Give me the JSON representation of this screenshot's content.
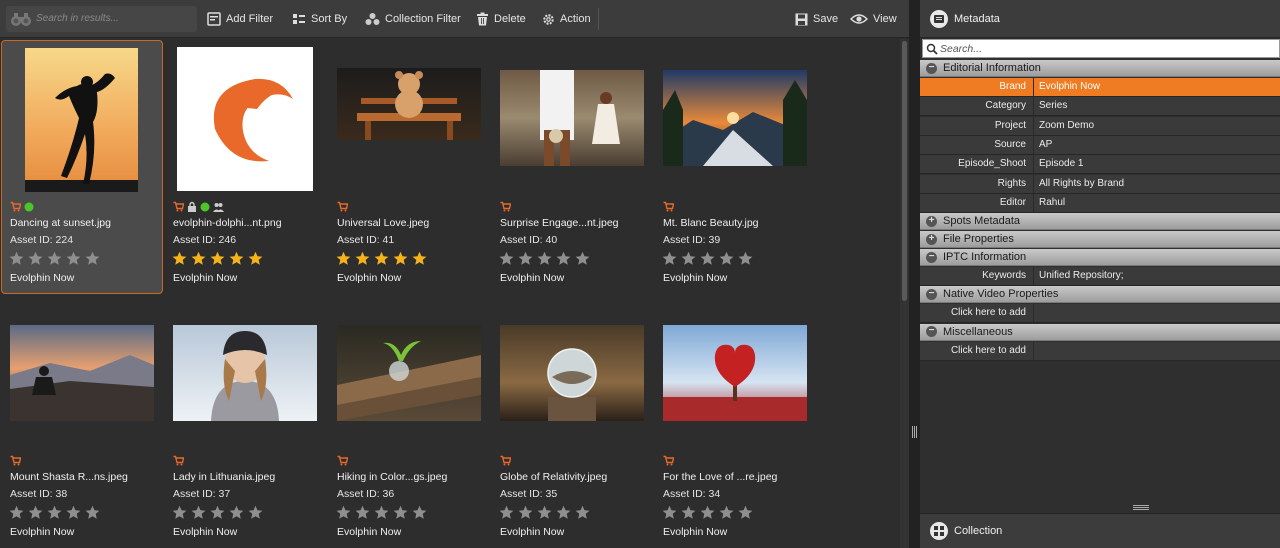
{
  "toolbar": {
    "search_placeholder": "Search in results...",
    "add_filter": "Add Filter",
    "sort_by": "Sort By",
    "collection_filter": "Collection Filter",
    "delete": "Delete",
    "action": "Action",
    "save": "Save",
    "view": "View"
  },
  "assets": [
    {
      "name": "Dancing at sunset.jpg",
      "id": "Asset ID: 224",
      "brand": "Evolphin Now",
      "rating": 0,
      "icons": [
        "cart-icon",
        "green-status-icon"
      ],
      "selected": true
    },
    {
      "name": "evolphin-dolphi...nt.png",
      "id": "Asset ID: 246",
      "brand": "Evolphin Now",
      "rating": 5,
      "icons": [
        "cart-icon",
        "lock-icon",
        "green-status-icon",
        "users-icon"
      ]
    },
    {
      "name": "Universal Love.jpeg",
      "id": "Asset ID: 41",
      "brand": "Evolphin Now",
      "rating": 5,
      "icons": [
        "cart-icon"
      ]
    },
    {
      "name": "Surprise Engage...nt.jpeg",
      "id": "Asset ID: 40",
      "brand": "Evolphin Now",
      "rating": 0,
      "icons": [
        "cart-icon"
      ]
    },
    {
      "name": "Mt. Blanc Beauty.jpg",
      "id": "Asset ID: 39",
      "brand": "Evolphin Now",
      "rating": 0,
      "icons": [
        "cart-icon"
      ]
    },
    {
      "name": "Mount Shasta R...ns.jpeg",
      "id": "Asset ID: 38",
      "brand": "Evolphin Now",
      "rating": 0,
      "icons": [
        "cart-icon"
      ]
    },
    {
      "name": "Lady in Lithuania.jpeg",
      "id": "Asset ID: 37",
      "brand": "Evolphin Now",
      "rating": 0,
      "icons": [
        "cart-icon"
      ]
    },
    {
      "name": "Hiking in Color...gs.jpeg",
      "id": "Asset ID: 36",
      "brand": "Evolphin Now",
      "rating": 0,
      "icons": [
        "cart-icon"
      ]
    },
    {
      "name": "Globe of Relativity.jpeg",
      "id": "Asset ID: 35",
      "brand": "Evolphin Now",
      "rating": 0,
      "icons": [
        "cart-icon"
      ]
    },
    {
      "name": "For the Love of ...re.jpeg",
      "id": "Asset ID: 34",
      "brand": "Evolphin Now",
      "rating": 0,
      "icons": [
        "cart-icon"
      ]
    }
  ],
  "metadata": {
    "title": "Metadata",
    "search_placeholder": "Search...",
    "sections": [
      {
        "title": "Editorial Information",
        "expanded": true,
        "rows": [
          {
            "key": "Brand",
            "value": "Evolphin Now",
            "highlight": true
          },
          {
            "key": "Category",
            "value": "Series"
          },
          {
            "key": "Project",
            "value": "Zoom Demo"
          },
          {
            "key": "Source",
            "value": "AP"
          },
          {
            "key": "Episode_Shoot",
            "value": "Episode 1"
          },
          {
            "key": "Rights",
            "value": "All Rights by Brand"
          },
          {
            "key": "Editor",
            "value": "Rahul"
          }
        ]
      },
      {
        "title": "Spots Metadata",
        "expanded": false,
        "rows": []
      },
      {
        "title": "File Properties",
        "expanded": false,
        "rows": []
      },
      {
        "title": "IPTC Information",
        "expanded": true,
        "rows": [
          {
            "key": "Keywords",
            "value": "Unified Repository;"
          }
        ]
      },
      {
        "title": "Native Video Properties",
        "expanded": true,
        "rows": [
          {
            "key": "Click here to add",
            "value": ""
          }
        ]
      },
      {
        "title": "Miscellaneous",
        "expanded": true,
        "rows": [
          {
            "key": "Click here to add",
            "value": ""
          }
        ]
      }
    ]
  },
  "collection": {
    "title": "Collection"
  },
  "colors": {
    "accent": "#ef7b22",
    "star_on": "#f5b21a",
    "star_off": "#8f8f8f"
  }
}
